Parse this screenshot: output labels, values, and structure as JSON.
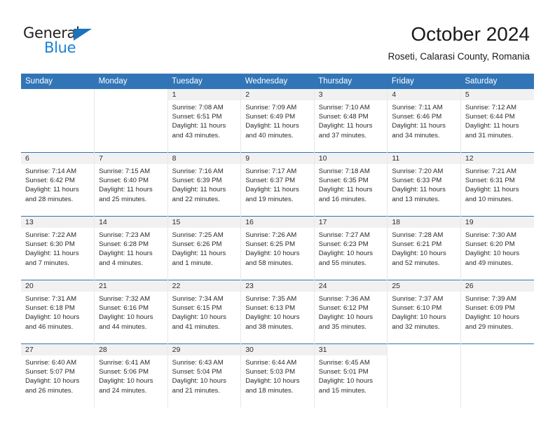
{
  "brand": {
    "name_top": "General",
    "name_bottom": "Blue",
    "color_dark": "#231f20",
    "color_blue": "#1c81d4"
  },
  "header": {
    "title": "October 2024",
    "subtitle": "Roseti, Calarasi County, Romania"
  },
  "theme": {
    "header_blue": "#3275b7",
    "daynum_band": "#f1f1f1",
    "column_divider": "#e8e8e8"
  },
  "weekdays": [
    "Sunday",
    "Monday",
    "Tuesday",
    "Wednesday",
    "Thursday",
    "Friday",
    "Saturday"
  ],
  "weeks": [
    [
      {
        "day": "",
        "sunrise": "",
        "sunset": "",
        "daylight1": "",
        "daylight2": "",
        "blank": true
      },
      {
        "day": "",
        "sunrise": "",
        "sunset": "",
        "daylight1": "",
        "daylight2": "",
        "blank": true
      },
      {
        "day": "1",
        "sunrise": "Sunrise: 7:08 AM",
        "sunset": "Sunset: 6:51 PM",
        "daylight1": "Daylight: 11 hours",
        "daylight2": "and 43 minutes."
      },
      {
        "day": "2",
        "sunrise": "Sunrise: 7:09 AM",
        "sunset": "Sunset: 6:49 PM",
        "daylight1": "Daylight: 11 hours",
        "daylight2": "and 40 minutes."
      },
      {
        "day": "3",
        "sunrise": "Sunrise: 7:10 AM",
        "sunset": "Sunset: 6:48 PM",
        "daylight1": "Daylight: 11 hours",
        "daylight2": "and 37 minutes."
      },
      {
        "day": "4",
        "sunrise": "Sunrise: 7:11 AM",
        "sunset": "Sunset: 6:46 PM",
        "daylight1": "Daylight: 11 hours",
        "daylight2": "and 34 minutes."
      },
      {
        "day": "5",
        "sunrise": "Sunrise: 7:12 AM",
        "sunset": "Sunset: 6:44 PM",
        "daylight1": "Daylight: 11 hours",
        "daylight2": "and 31 minutes."
      }
    ],
    [
      {
        "day": "6",
        "sunrise": "Sunrise: 7:14 AM",
        "sunset": "Sunset: 6:42 PM",
        "daylight1": "Daylight: 11 hours",
        "daylight2": "and 28 minutes."
      },
      {
        "day": "7",
        "sunrise": "Sunrise: 7:15 AM",
        "sunset": "Sunset: 6:40 PM",
        "daylight1": "Daylight: 11 hours",
        "daylight2": "and 25 minutes."
      },
      {
        "day": "8",
        "sunrise": "Sunrise: 7:16 AM",
        "sunset": "Sunset: 6:39 PM",
        "daylight1": "Daylight: 11 hours",
        "daylight2": "and 22 minutes."
      },
      {
        "day": "9",
        "sunrise": "Sunrise: 7:17 AM",
        "sunset": "Sunset: 6:37 PM",
        "daylight1": "Daylight: 11 hours",
        "daylight2": "and 19 minutes."
      },
      {
        "day": "10",
        "sunrise": "Sunrise: 7:18 AM",
        "sunset": "Sunset: 6:35 PM",
        "daylight1": "Daylight: 11 hours",
        "daylight2": "and 16 minutes."
      },
      {
        "day": "11",
        "sunrise": "Sunrise: 7:20 AM",
        "sunset": "Sunset: 6:33 PM",
        "daylight1": "Daylight: 11 hours",
        "daylight2": "and 13 minutes."
      },
      {
        "day": "12",
        "sunrise": "Sunrise: 7:21 AM",
        "sunset": "Sunset: 6:31 PM",
        "daylight1": "Daylight: 11 hours",
        "daylight2": "and 10 minutes."
      }
    ],
    [
      {
        "day": "13",
        "sunrise": "Sunrise: 7:22 AM",
        "sunset": "Sunset: 6:30 PM",
        "daylight1": "Daylight: 11 hours",
        "daylight2": "and 7 minutes."
      },
      {
        "day": "14",
        "sunrise": "Sunrise: 7:23 AM",
        "sunset": "Sunset: 6:28 PM",
        "daylight1": "Daylight: 11 hours",
        "daylight2": "and 4 minutes."
      },
      {
        "day": "15",
        "sunrise": "Sunrise: 7:25 AM",
        "sunset": "Sunset: 6:26 PM",
        "daylight1": "Daylight: 11 hours",
        "daylight2": "and 1 minute."
      },
      {
        "day": "16",
        "sunrise": "Sunrise: 7:26 AM",
        "sunset": "Sunset: 6:25 PM",
        "daylight1": "Daylight: 10 hours",
        "daylight2": "and 58 minutes."
      },
      {
        "day": "17",
        "sunrise": "Sunrise: 7:27 AM",
        "sunset": "Sunset: 6:23 PM",
        "daylight1": "Daylight: 10 hours",
        "daylight2": "and 55 minutes."
      },
      {
        "day": "18",
        "sunrise": "Sunrise: 7:28 AM",
        "sunset": "Sunset: 6:21 PM",
        "daylight1": "Daylight: 10 hours",
        "daylight2": "and 52 minutes."
      },
      {
        "day": "19",
        "sunrise": "Sunrise: 7:30 AM",
        "sunset": "Sunset: 6:20 PM",
        "daylight1": "Daylight: 10 hours",
        "daylight2": "and 49 minutes."
      }
    ],
    [
      {
        "day": "20",
        "sunrise": "Sunrise: 7:31 AM",
        "sunset": "Sunset: 6:18 PM",
        "daylight1": "Daylight: 10 hours",
        "daylight2": "and 46 minutes."
      },
      {
        "day": "21",
        "sunrise": "Sunrise: 7:32 AM",
        "sunset": "Sunset: 6:16 PM",
        "daylight1": "Daylight: 10 hours",
        "daylight2": "and 44 minutes."
      },
      {
        "day": "22",
        "sunrise": "Sunrise: 7:34 AM",
        "sunset": "Sunset: 6:15 PM",
        "daylight1": "Daylight: 10 hours",
        "daylight2": "and 41 minutes."
      },
      {
        "day": "23",
        "sunrise": "Sunrise: 7:35 AM",
        "sunset": "Sunset: 6:13 PM",
        "daylight1": "Daylight: 10 hours",
        "daylight2": "and 38 minutes."
      },
      {
        "day": "24",
        "sunrise": "Sunrise: 7:36 AM",
        "sunset": "Sunset: 6:12 PM",
        "daylight1": "Daylight: 10 hours",
        "daylight2": "and 35 minutes."
      },
      {
        "day": "25",
        "sunrise": "Sunrise: 7:37 AM",
        "sunset": "Sunset: 6:10 PM",
        "daylight1": "Daylight: 10 hours",
        "daylight2": "and 32 minutes."
      },
      {
        "day": "26",
        "sunrise": "Sunrise: 7:39 AM",
        "sunset": "Sunset: 6:09 PM",
        "daylight1": "Daylight: 10 hours",
        "daylight2": "and 29 minutes."
      }
    ],
    [
      {
        "day": "27",
        "sunrise": "Sunrise: 6:40 AM",
        "sunset": "Sunset: 5:07 PM",
        "daylight1": "Daylight: 10 hours",
        "daylight2": "and 26 minutes."
      },
      {
        "day": "28",
        "sunrise": "Sunrise: 6:41 AM",
        "sunset": "Sunset: 5:06 PM",
        "daylight1": "Daylight: 10 hours",
        "daylight2": "and 24 minutes."
      },
      {
        "day": "29",
        "sunrise": "Sunrise: 6:43 AM",
        "sunset": "Sunset: 5:04 PM",
        "daylight1": "Daylight: 10 hours",
        "daylight2": "and 21 minutes."
      },
      {
        "day": "30",
        "sunrise": "Sunrise: 6:44 AM",
        "sunset": "Sunset: 5:03 PM",
        "daylight1": "Daylight: 10 hours",
        "daylight2": "and 18 minutes."
      },
      {
        "day": "31",
        "sunrise": "Sunrise: 6:45 AM",
        "sunset": "Sunset: 5:01 PM",
        "daylight1": "Daylight: 10 hours",
        "daylight2": "and 15 minutes."
      },
      {
        "day": "",
        "sunrise": "",
        "sunset": "",
        "daylight1": "",
        "daylight2": "",
        "blank": true
      },
      {
        "day": "",
        "sunrise": "",
        "sunset": "",
        "daylight1": "",
        "daylight2": "",
        "blank": true
      }
    ]
  ]
}
